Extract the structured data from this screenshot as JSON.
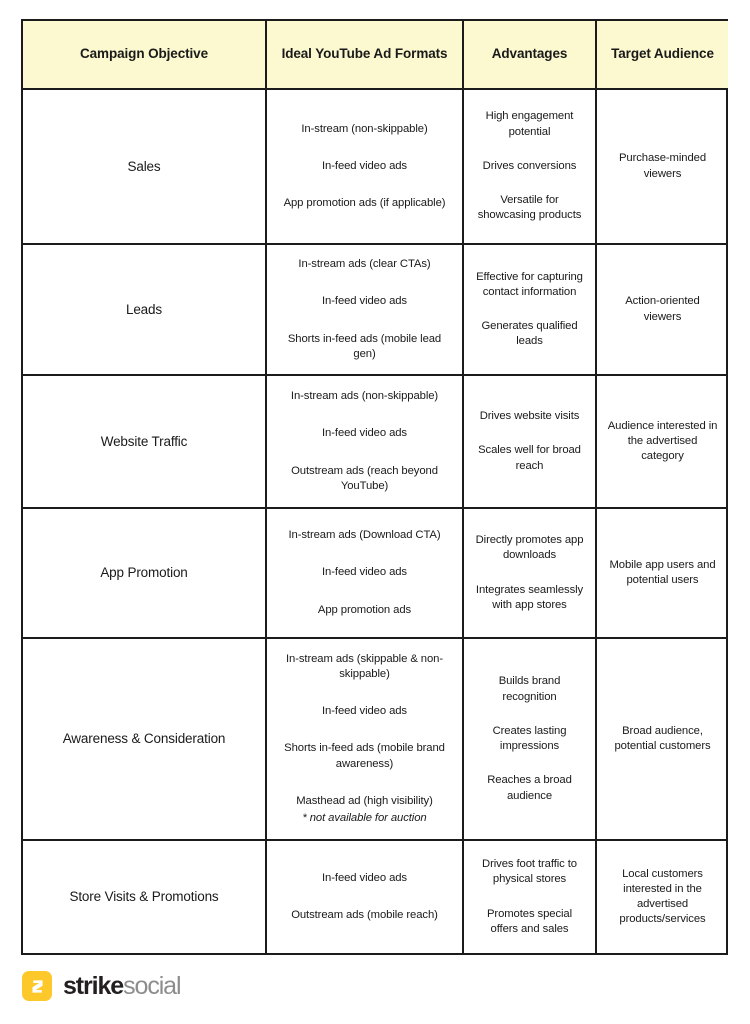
{
  "table": {
    "headers": [
      "Campaign Objective",
      "Ideal YouTube Ad Formats",
      "Advantages",
      "Target Audience"
    ],
    "rows": [
      {
        "objective": "Sales",
        "formats": [
          "In-stream (non-skippable)",
          "In-feed video ads",
          "App promotion ads (if applicable)"
        ],
        "advantages": [
          "High engagement potential",
          "Drives conversions",
          "Versatile for showcasing products"
        ],
        "audience": [
          "Purchase-minded viewers"
        ]
      },
      {
        "objective": "Leads",
        "formats": [
          "In-stream ads (clear CTAs)",
          "In-feed video ads",
          "Shorts in-feed ads (mobile lead gen)"
        ],
        "advantages": [
          "Effective for capturing contact information",
          "Generates qualified leads"
        ],
        "audience": [
          "Action-oriented viewers"
        ]
      },
      {
        "objective": "Website Traffic",
        "formats": [
          "In-stream ads (non-skippable)",
          "In-feed video ads",
          "Outstream ads (reach beyond YouTube)"
        ],
        "advantages": [
          "Drives website visits",
          "Scales well for broad reach"
        ],
        "audience": [
          "Audience interested in the advertised category"
        ]
      },
      {
        "objective": "App Promotion",
        "formats": [
          "In-stream ads (Download CTA)",
          "In-feed video ads",
          "App promotion ads"
        ],
        "advantages": [
          "Directly promotes app downloads",
          "Integrates seamlessly with app stores"
        ],
        "audience": [
          "Mobile app users and potential users"
        ]
      },
      {
        "objective": "Awareness & Consideration",
        "formats": [
          "In-stream ads (skippable & non-skippable)",
          "In-feed video ads",
          "Shorts in-feed ads (mobile brand awareness)",
          "Masthead ad (high visibility)"
        ],
        "formats_note": "* not available for auction",
        "advantages": [
          "Builds brand recognition",
          "Creates lasting impressions",
          "Reaches a broad audience"
        ],
        "audience": [
          "Broad audience, potential customers"
        ]
      },
      {
        "objective": "Store Visits & Promotions",
        "formats": [
          "In-feed video ads",
          "Outstream ads (mobile reach)"
        ],
        "advantages": [
          "Drives foot traffic to physical stores",
          "Promotes special offers and sales"
        ],
        "audience": [
          "Local customers interested in the advertised products/services"
        ]
      }
    ]
  },
  "footer": {
    "logo": {
      "mark_icon": "strike-s-mark-icon",
      "brand_primary": "strike",
      "brand_secondary": "social"
    }
  },
  "colors": {
    "header_background": "#FCF8CF",
    "border": "#1B1B1B",
    "logo_yellow": "#FCC82A",
    "logo_primary_text": "#231F20",
    "logo_secondary_text": "#8D8D8D"
  }
}
